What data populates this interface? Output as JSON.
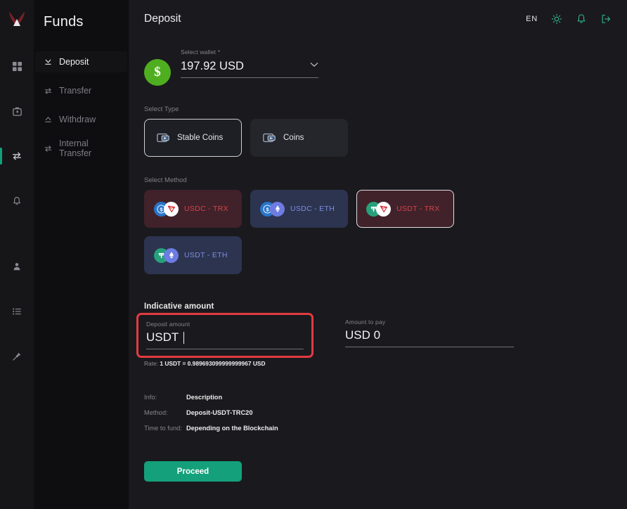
{
  "rail": {
    "logo_name": "app-logo",
    "items": [
      {
        "name": "dashboard",
        "icon": "grid-icon",
        "active": false
      },
      {
        "name": "wallet",
        "icon": "briefcase-icon",
        "active": false
      },
      {
        "name": "funds",
        "icon": "transfer-icon",
        "active": true
      },
      {
        "name": "alerts",
        "icon": "bell-icon",
        "active": false
      },
      {
        "name": "profile",
        "icon": "person-icon",
        "active": false
      },
      {
        "name": "orders",
        "icon": "list-icon",
        "active": false
      },
      {
        "name": "support",
        "icon": "pin-icon",
        "active": false
      }
    ]
  },
  "sidebar": {
    "title": "Funds",
    "items": [
      {
        "label": "Deposit",
        "icon": "download-icon",
        "active": true
      },
      {
        "label": "Transfer",
        "icon": "exchange-icon",
        "active": false
      },
      {
        "label": "Withdraw",
        "icon": "upload-icon",
        "active": false
      },
      {
        "label": "Internal Transfer",
        "icon": "exchange-icon",
        "active": false
      }
    ]
  },
  "topbar": {
    "title": "Deposit",
    "language": "EN",
    "theme_icon": "sun-icon",
    "notifications_icon": "bell-icon",
    "logout_icon": "logout-icon"
  },
  "wallet": {
    "badge_symbol": "$",
    "label": "Select wallet *",
    "value": "197.92 USD"
  },
  "select_type": {
    "label": "Select Type",
    "options": [
      {
        "label": "Stable Coins",
        "selected": true
      },
      {
        "label": "Coins",
        "selected": false
      }
    ]
  },
  "select_method": {
    "label": "Select Method",
    "options": [
      {
        "label": "USDC - TRX",
        "chain": "trx",
        "coin1": "usdc",
        "coin2": "trx",
        "selected": false
      },
      {
        "label": "USDC - ETH",
        "chain": "eth",
        "coin1": "usdc",
        "coin2": "eth",
        "selected": false
      },
      {
        "label": "USDT - TRX",
        "chain": "trx",
        "coin1": "usdt",
        "coin2": "trx",
        "selected": true
      },
      {
        "label": "USDT - ETH",
        "chain": "eth",
        "coin1": "usdt",
        "coin2": "eth",
        "selected": false
      }
    ]
  },
  "amounts": {
    "section_title": "Indicative amount",
    "deposit_label": "Deposit amount",
    "deposit_value": "USDT",
    "pay_label": "Amount to pay",
    "pay_value": "USD 0",
    "rate_key": "Rate:",
    "rate_value": "1 USDT = 0.989693099999999967 USD"
  },
  "info": {
    "rows": [
      {
        "key": "Info:",
        "value": "Description"
      },
      {
        "key": "Method:",
        "value": "Deposit-USDT-TRC20"
      },
      {
        "key": "Time to fund:",
        "value": "Depending on the Blockchain"
      }
    ]
  },
  "actions": {
    "proceed_label": "Proceed"
  },
  "colors": {
    "accent_green": "#14a07b",
    "wallet_green": "#4fae1f",
    "trx_red": "#d4424c",
    "eth_blue": "#7e8ee0",
    "highlight_red": "#e23b42"
  }
}
